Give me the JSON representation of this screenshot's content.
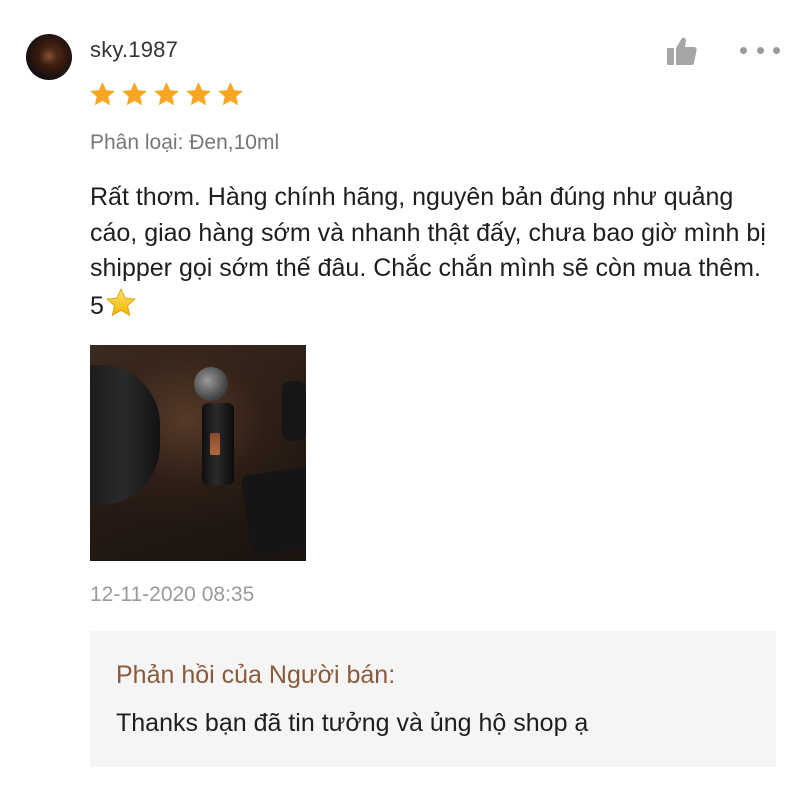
{
  "review": {
    "username": "sky.1987",
    "rating": 5,
    "rating_max": 5,
    "variation": "Phân loại: Đen,10ml",
    "text": "Rất thơm. Hàng chính hãng, nguyên bản đúng như quảng cáo, giao hàng sớm và nhanh thật đấy, chưa bao giờ mình bị shipper gọi sớm thế đâu. Chắc chắn mình sẽ còn mua thêm. 5",
    "text_trailing_icon": "star-emoji-icon",
    "timestamp": "12-11-2020 08:35"
  },
  "seller_response": {
    "title": "Phản hồi của Người bán:",
    "text": "Thanks bạn đã tin tưởng và ủng hộ shop ạ"
  },
  "icons": {
    "like": "thumbs-up-icon",
    "more": "more-horizontal-icon",
    "rating": "star-icon"
  },
  "colors": {
    "star": "#f6a623",
    "seller_title": "#8a5a3a",
    "seller_box_bg": "#f5f5f5",
    "muted_text": "#9a9a9a"
  }
}
